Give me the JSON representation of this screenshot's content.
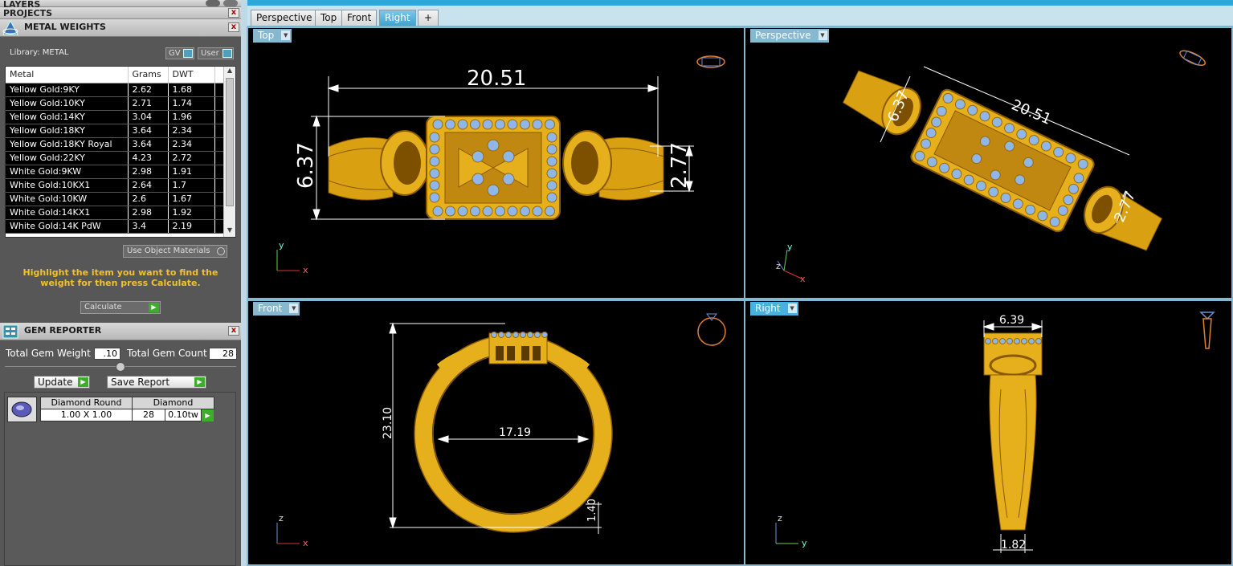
{
  "panels": {
    "layers_title": "LAYERS",
    "projects_title": "PROJECTS",
    "metal_weights_title": "METAL WEIGHTS",
    "gem_reporter_title": "GEM REPORTER",
    "close_glyph": "x"
  },
  "metal": {
    "library_label": "Library: METAL",
    "toggle_gv": "GV",
    "toggle_user": "User",
    "columns": [
      "Metal",
      "Grams",
      "DWT"
    ],
    "rows": [
      [
        "Yellow Gold:9KY",
        "2.62",
        "1.68"
      ],
      [
        "Yellow Gold:10KY",
        "2.71",
        "1.74"
      ],
      [
        "Yellow Gold:14KY",
        "3.04",
        "1.96"
      ],
      [
        "Yellow Gold:18KY",
        "3.64",
        "2.34"
      ],
      [
        "Yellow Gold:18KY Royal",
        "3.64",
        "2.34"
      ],
      [
        "Yellow Gold:22KY",
        "4.23",
        "2.72"
      ],
      [
        "White Gold:9KW",
        "2.98",
        "1.91"
      ],
      [
        "White Gold:10KX1",
        "2.64",
        "1.7"
      ],
      [
        "White Gold:10KW",
        "2.6",
        "1.67"
      ],
      [
        "White Gold:14KX1",
        "2.98",
        "1.92"
      ],
      [
        "White Gold:14K PdW",
        "3.4",
        "2.19"
      ]
    ],
    "use_object_materials": "Use Object Materials",
    "hint": "Highlight the item you want to find the weight for then press Calculate.",
    "calculate": "Calculate"
  },
  "gems": {
    "total_weight_label": "Total Gem Weight",
    "total_weight_value": ".10",
    "total_count_label": "Total Gem Count",
    "total_count_value": "28",
    "update": "Update",
    "save_report": "Save Report",
    "row": {
      "shape": "Diamond Round",
      "size": "1.00 X 1.00",
      "type": "Diamond",
      "count": "28",
      "weight": "0.10tw"
    }
  },
  "tabs": [
    "Perspective",
    "Top",
    "Front",
    "Right",
    "+"
  ],
  "active_tab": "Right",
  "viewports": {
    "top": {
      "label": "Top",
      "dims": [
        "20.51",
        "6.37",
        "2.77"
      ],
      "axes": [
        "y",
        "x"
      ]
    },
    "perspective": {
      "label": "Perspective",
      "dims": [
        "20.51",
        "6.37",
        "2.77"
      ],
      "axes": [
        "y",
        "z",
        "x"
      ]
    },
    "front": {
      "label": "Front",
      "dims": [
        "23.10",
        "17.19",
        "1.40"
      ],
      "axes": [
        "z",
        "x"
      ]
    },
    "right": {
      "label": "Right",
      "dims": [
        "6.39",
        "1.82"
      ],
      "axes": [
        "z",
        "y"
      ]
    }
  },
  "colors": {
    "gold": "#e6b01c",
    "gold_dark": "#9a6a06",
    "gem": "#8fb6e8",
    "viewport_border": "#86b8d0",
    "accent": "#2ba9dd"
  }
}
